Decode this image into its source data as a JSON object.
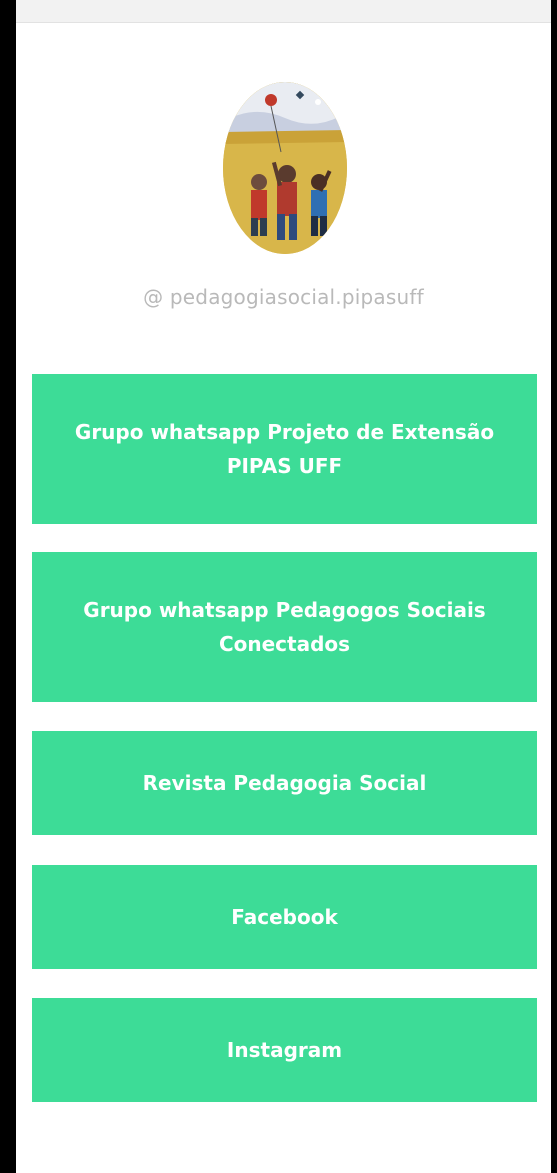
{
  "profile": {
    "handle": "@ pedagogiasocial.pipasuff",
    "avatar_icon": "children-flying-kites-painting-icon"
  },
  "links": [
    {
      "label": "Grupo whatsapp Projeto de Extensão PIPAS UFF"
    },
    {
      "label": "Grupo whatsapp Pedagogos Sociais Conectados"
    },
    {
      "label": "Revista Pedagogia Social"
    },
    {
      "label": "Facebook"
    },
    {
      "label": "Instagram"
    }
  ],
  "colors": {
    "button_bg": "#3ddc97",
    "button_text": "#ffffff",
    "handle_text": "#b9b9b9",
    "frame": "#000000"
  }
}
